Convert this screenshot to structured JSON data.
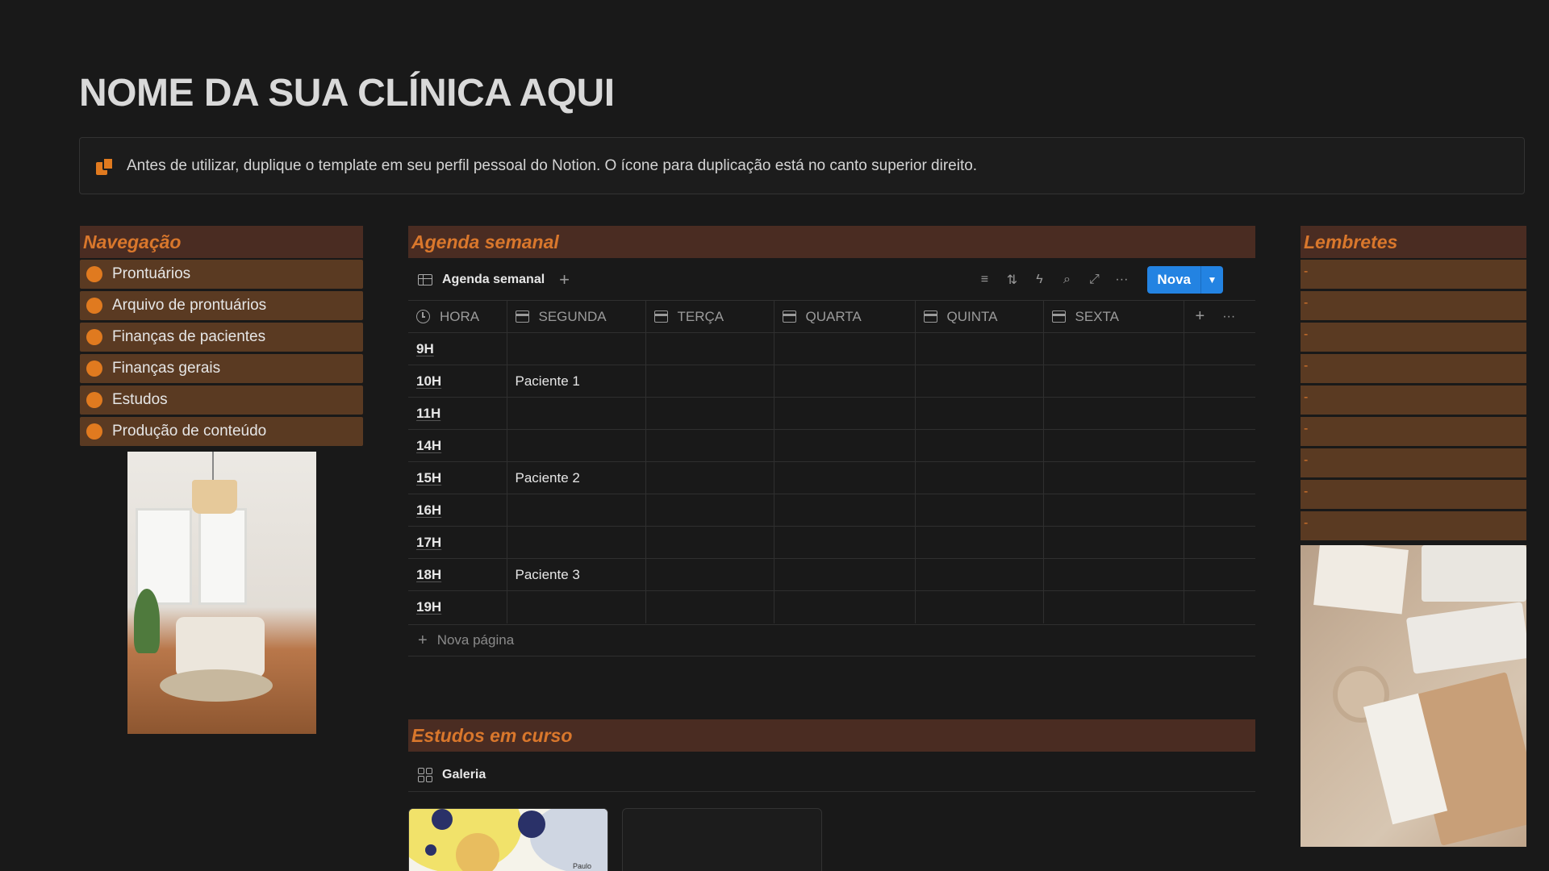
{
  "page": {
    "title": "NOME DA SUA CLÍNICA AQUI",
    "callout_text": "Antes de utilizar, duplique o template em seu perfil pessoal do Notion. O ícone para duplicação está no canto superior direito."
  },
  "navigation": {
    "header": "Navegação",
    "items": [
      {
        "label": "Prontuários"
      },
      {
        "label": "Arquivo de prontuários"
      },
      {
        "label": "Finanças de pacientes"
      },
      {
        "label": "Finanças gerais"
      },
      {
        "label": "Estudos"
      },
      {
        "label": "Produção de conteúdo"
      }
    ]
  },
  "agenda": {
    "header": "Agenda semanal",
    "view_label": "Agenda semanal",
    "new_button": "Nova",
    "columns": [
      "HORA",
      "SEGUNDA",
      "TERÇA",
      "QUARTA",
      "QUINTA",
      "SEXTA"
    ],
    "rows": [
      {
        "hour": "9H",
        "segunda": ""
      },
      {
        "hour": "10H",
        "segunda": "Paciente 1"
      },
      {
        "hour": "11H",
        "segunda": ""
      },
      {
        "hour": "14H",
        "segunda": ""
      },
      {
        "hour": "15H",
        "segunda": "Paciente 2"
      },
      {
        "hour": "16H",
        "segunda": ""
      },
      {
        "hour": "17H",
        "segunda": ""
      },
      {
        "hour": "18H",
        "segunda": "Paciente 3"
      },
      {
        "hour": "19H",
        "segunda": ""
      }
    ],
    "new_page_label": "Nova página"
  },
  "studies": {
    "header": "Estudos em curso",
    "view_label": "Galeria",
    "card_caption": "Paulo"
  },
  "reminders": {
    "header": "Lembretes",
    "items": [
      "-",
      "-",
      "-",
      "-",
      "-",
      "-",
      "-",
      "-",
      "-"
    ]
  },
  "colors": {
    "accent_orange": "#e07a1f",
    "section_bg": "#4a2c22",
    "item_bg": "#5a3a22",
    "button_blue": "#2383e2"
  }
}
